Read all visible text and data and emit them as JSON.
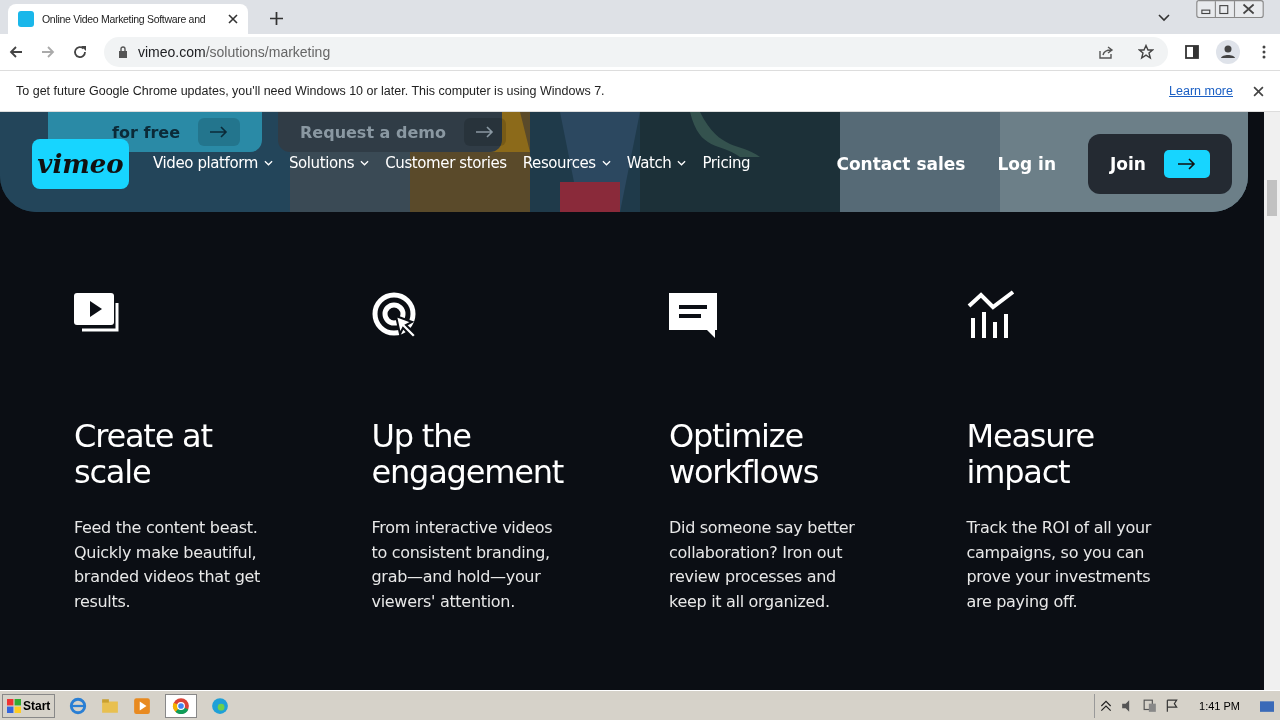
{
  "browser": {
    "tab_title": "Online Video Marketing Software and",
    "url_host": "vimeo.com",
    "url_path": "/solutions/marketing",
    "infobar": {
      "message": "To get future Google Chrome updates, you'll need Windows 10 or later. This computer is using Windows 7.",
      "link": "Learn more"
    }
  },
  "hero_buttons": [
    {
      "label": "for free",
      "kind": "primary"
    },
    {
      "label": "Request a demo",
      "kind": "secondary"
    }
  ],
  "nav": {
    "logo": "vimeo",
    "items": [
      {
        "label": "Video platform",
        "dropdown": true
      },
      {
        "label": "Solutions",
        "dropdown": true
      },
      {
        "label": "Customer stories",
        "dropdown": false
      },
      {
        "label": "Resources",
        "dropdown": true
      },
      {
        "label": "Watch",
        "dropdown": true
      },
      {
        "label": "Pricing",
        "dropdown": false
      }
    ],
    "contact": "Contact sales",
    "login": "Log in",
    "join": "Join"
  },
  "features": [
    {
      "title": "Create at scale",
      "text": "Feed the content beast. Quickly make beautiful, branded videos that get results."
    },
    {
      "title": "Up the engagement",
      "text": "From interactive videos to consistent branding, grab—and hold—your viewers' attention."
    },
    {
      "title": "Optimize workflows",
      "text": "Did someone say better collaboration? Iron out review processes and keep it all organized."
    },
    {
      "title": "Measure impact",
      "text": "Track the ROI of all your campaigns, so you can prove your investments are paying off."
    }
  ],
  "taskbar": {
    "start": "Start",
    "clock": "1:41 PM"
  }
}
